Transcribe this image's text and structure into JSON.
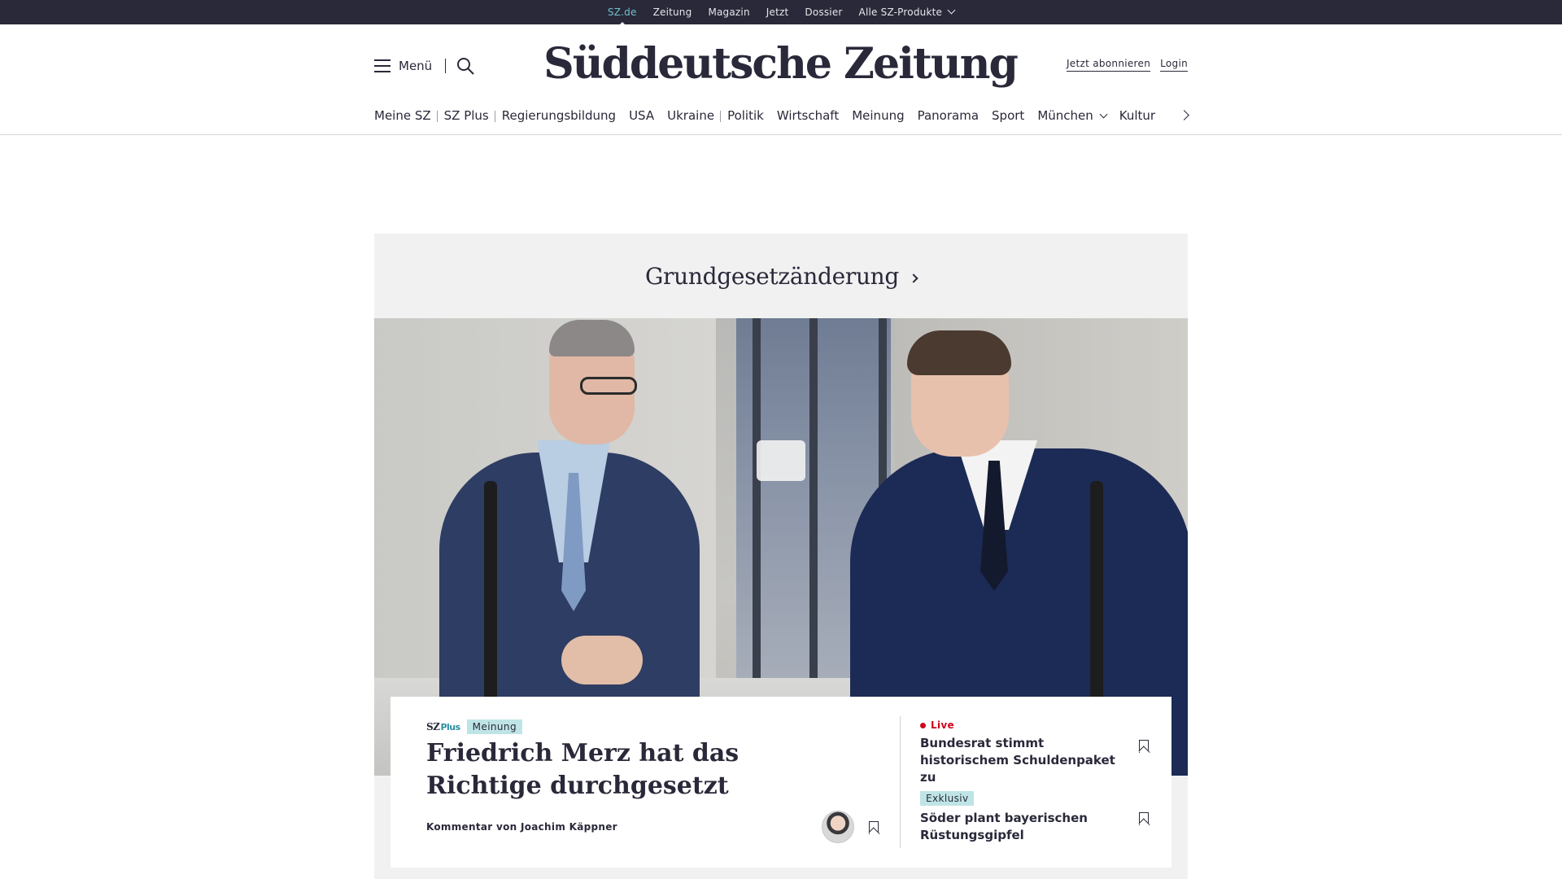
{
  "topbar": {
    "items": [
      "SZ.de",
      "Zeitung",
      "Magazin",
      "Jetzt",
      "Dossier",
      "Alle SZ-Produkte"
    ],
    "active": "SZ.de"
  },
  "header": {
    "menu_label": "Menü",
    "logo": "Süddeutsche Zeitung",
    "subscribe": "Jetzt abonnieren",
    "login": "Login"
  },
  "nav": {
    "items": [
      "Meine SZ",
      "SZ Plus",
      "Regierungsbildung",
      "USA",
      "Ukraine",
      "Politik",
      "Wirtschaft",
      "Meinung",
      "Panorama",
      "Sport",
      "München",
      "Kultur"
    ]
  },
  "topic": {
    "label": "Grundgesetzänderung"
  },
  "lead": {
    "plus_brand": "SZ",
    "plus_suffix": "Plus",
    "tag": "Meinung",
    "headline": "Friedrich Merz hat das Richtige durchgesetzt",
    "byline": "Kommentar von Joachim Käppner"
  },
  "side": [
    {
      "badge": "Live",
      "title": "Bundesrat stimmt historischem Schuldenpaket zu"
    },
    {
      "badge": "Exklusiv",
      "title": "Söder plant bayerischen Rüstungsgipfel"
    }
  ],
  "colors": {
    "topbar_bg": "#29293a",
    "accent_teal": "#71c1c7",
    "tag_bg": "#bfe4e6",
    "live_red": "#d0021b"
  }
}
